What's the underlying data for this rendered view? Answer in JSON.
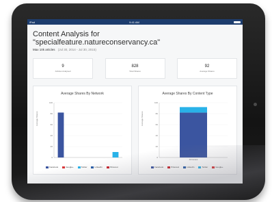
{
  "status": {
    "left": "iPad",
    "center": "9:41 AM"
  },
  "page": {
    "title_line1": "Content Analysis for",
    "title_line2": "\"specialfeature.natureconservancy.ca\"",
    "subtitle": "Max 10k articles",
    "date_range": "(Jul 30, 2014 - Jul 30, 2015)"
  },
  "stats": [
    {
      "value": "9",
      "label": "Articles Analysed"
    },
    {
      "value": "828",
      "label": "Total Shares"
    },
    {
      "value": "92",
      "label": "Average Shares"
    }
  ],
  "colors": {
    "facebook": "#3b55a0",
    "linkedin": "#2a5ea8",
    "google": "#d9383a",
    "pinterest": "#c8232c",
    "twitter": "#29b2e8"
  },
  "chart_data": [
    {
      "type": "bar",
      "title": "Average Shares By Network",
      "ylabel": "Average Shares",
      "ylim": [
        0,
        100
      ],
      "yticks": [
        0,
        20,
        40,
        60,
        80,
        100
      ],
      "categories": [
        "Facebook",
        "LinkedIn",
        "Google+",
        "Pinterest",
        "Twitter"
      ],
      "values": [
        82,
        0,
        0,
        0,
        10
      ],
      "legend": [
        "Facebook",
        "Google+",
        "Twitter",
        "LinkedIn",
        "Pinterest"
      ]
    },
    {
      "type": "bar",
      "title": "Average Shares By Content Type",
      "ylabel": "Average Shares",
      "ylim": [
        0,
        100
      ],
      "yticks": [
        0,
        20,
        40,
        60,
        80,
        100
      ],
      "categories": [
        "All Content"
      ],
      "series": [
        {
          "name": "Facebook",
          "values": [
            82
          ]
        },
        {
          "name": "Twitter",
          "values": [
            10
          ]
        }
      ],
      "legend": [
        "Facebook",
        "Pinterest",
        "LinkedIn",
        "Twitter",
        "Google+"
      ]
    }
  ]
}
